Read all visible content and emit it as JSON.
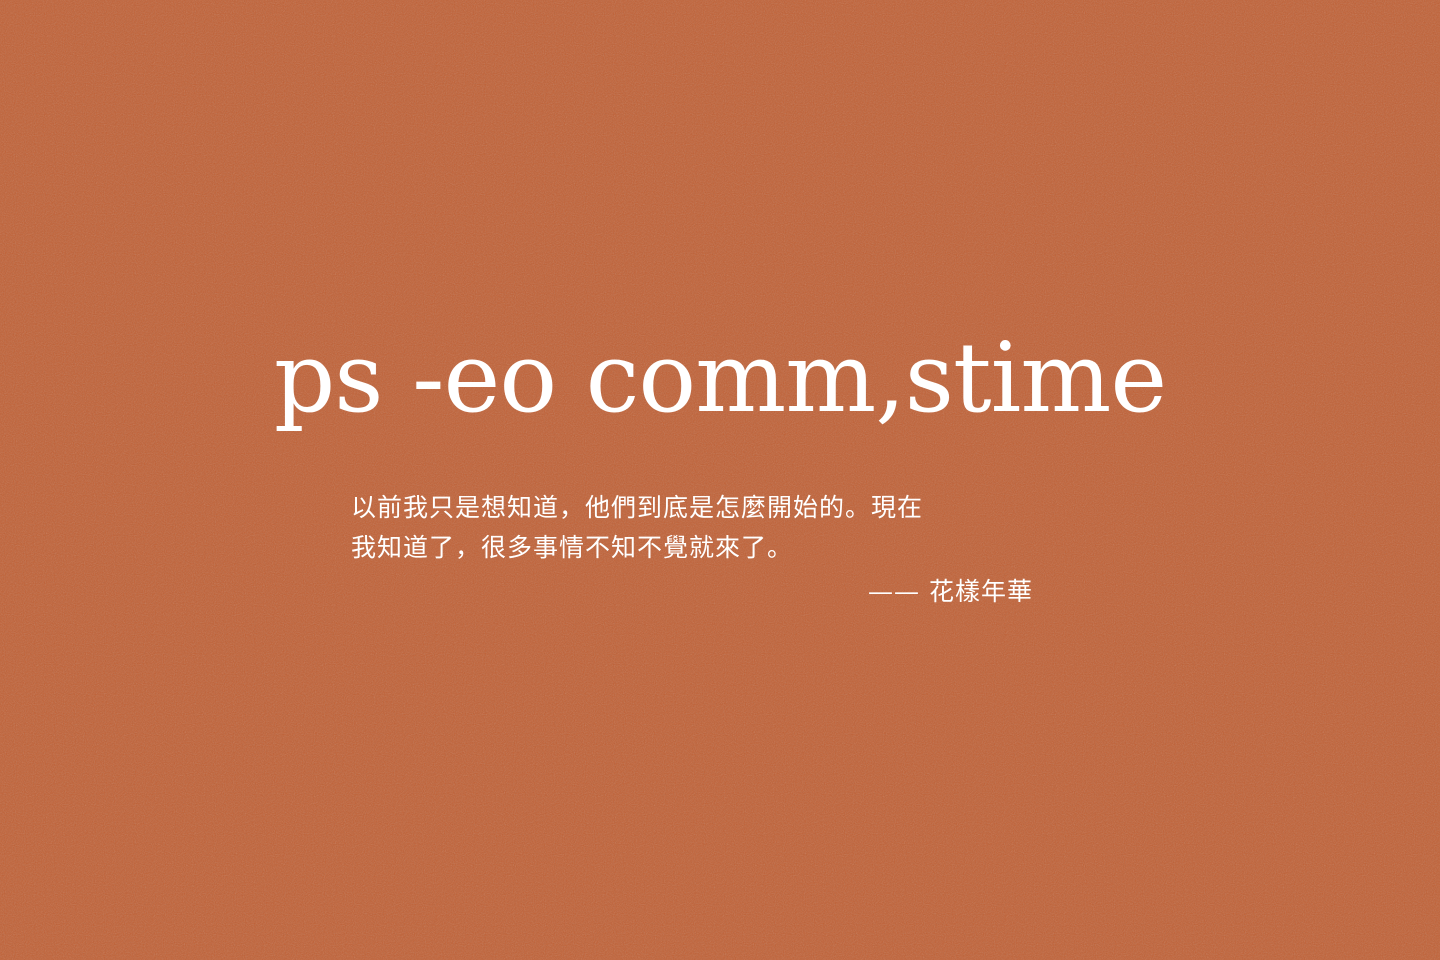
{
  "colors": {
    "background": "#c15f33",
    "text": "#ffffff"
  },
  "headline": {
    "text": "ps -eo comm,stime"
  },
  "quote": {
    "lines": [
      "以前我只是想知道，他們到底是怎麼開始的。現在",
      "我知道了，很多事情不知不覺就來了。"
    ],
    "attribution": "—— 花樣年華"
  }
}
